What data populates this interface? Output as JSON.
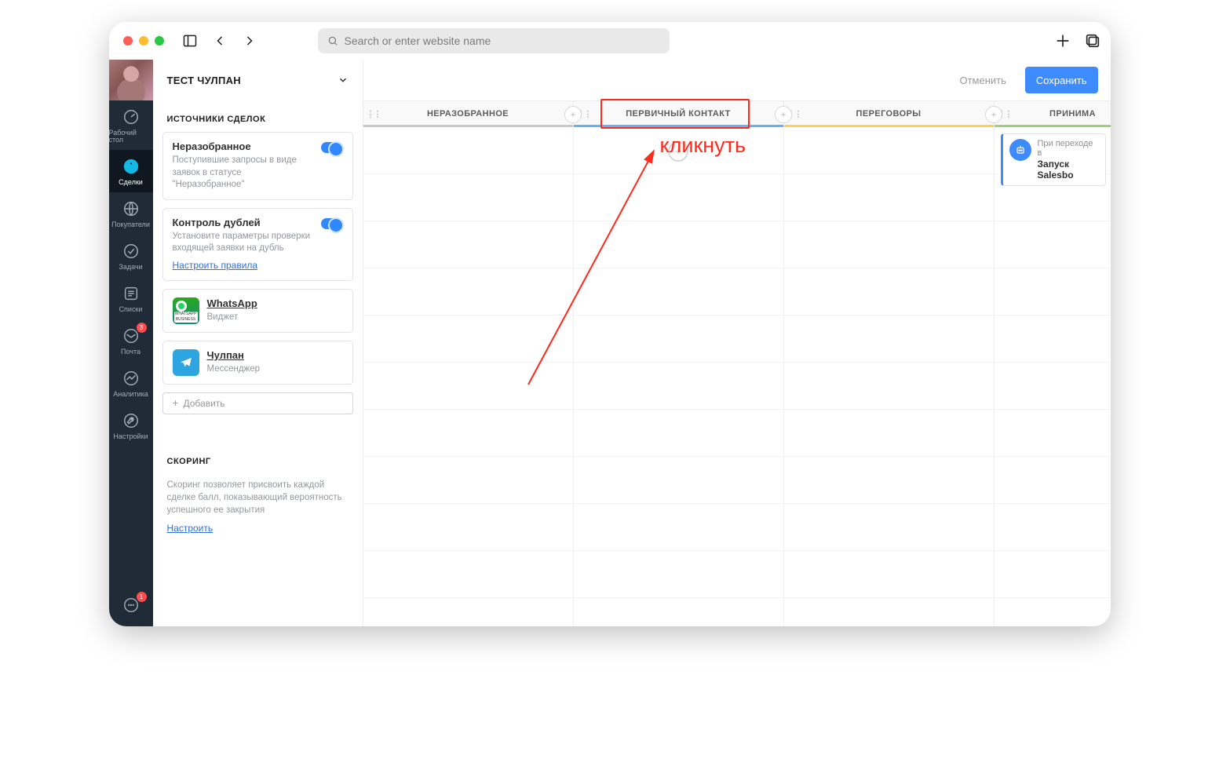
{
  "browser": {
    "search_placeholder": "Search or enter website name"
  },
  "nav": {
    "items": [
      {
        "label": "Рабочий стол"
      },
      {
        "label": "Сделки"
      },
      {
        "label": "Покупатели"
      },
      {
        "label": "Задачи"
      },
      {
        "label": "Списки"
      },
      {
        "label": "Почта",
        "badge": "3"
      },
      {
        "label": "Аналитика"
      },
      {
        "label": "Настройки"
      }
    ],
    "chat_badge": "1"
  },
  "panel": {
    "title": "ТЕСТ ЧУЛПАН",
    "sources_label": "ИСТОЧНИКИ СДЕЛОК",
    "unsor": {
      "title": "Неразобранное",
      "desc": "Поступившие запросы в виде заявок в статусе \"Неразобранное\""
    },
    "dupe": {
      "title": "Контроль дублей",
      "desc": "Установите параметры проверки входящей заявки на дубль",
      "link": "Настроить правила"
    },
    "src": [
      {
        "title": "WhatsApp",
        "sub": "Виджет"
      },
      {
        "title": "Чулпан",
        "sub": "Мессенджер"
      }
    ],
    "add": "Добавить",
    "scoring": {
      "label": "СКОРИНГ",
      "desc": "Скоринг позволяет присвоить каждой сделке балл, показывающий вероятность успешного ее закрытия",
      "link": "Настроить"
    }
  },
  "main": {
    "cancel": "Отменить",
    "save": "Сохранить",
    "columns": [
      "НЕРАЗОБРАННОЕ",
      "ПЕРВИЧНЫЙ КОНТАКТ",
      "ПЕРЕГОВОРЫ",
      "ПРИНИМА"
    ],
    "deal": {
      "l1": "При переходе в",
      "l2": "Запуск Salesbo"
    },
    "annotation": "кликнуть"
  }
}
